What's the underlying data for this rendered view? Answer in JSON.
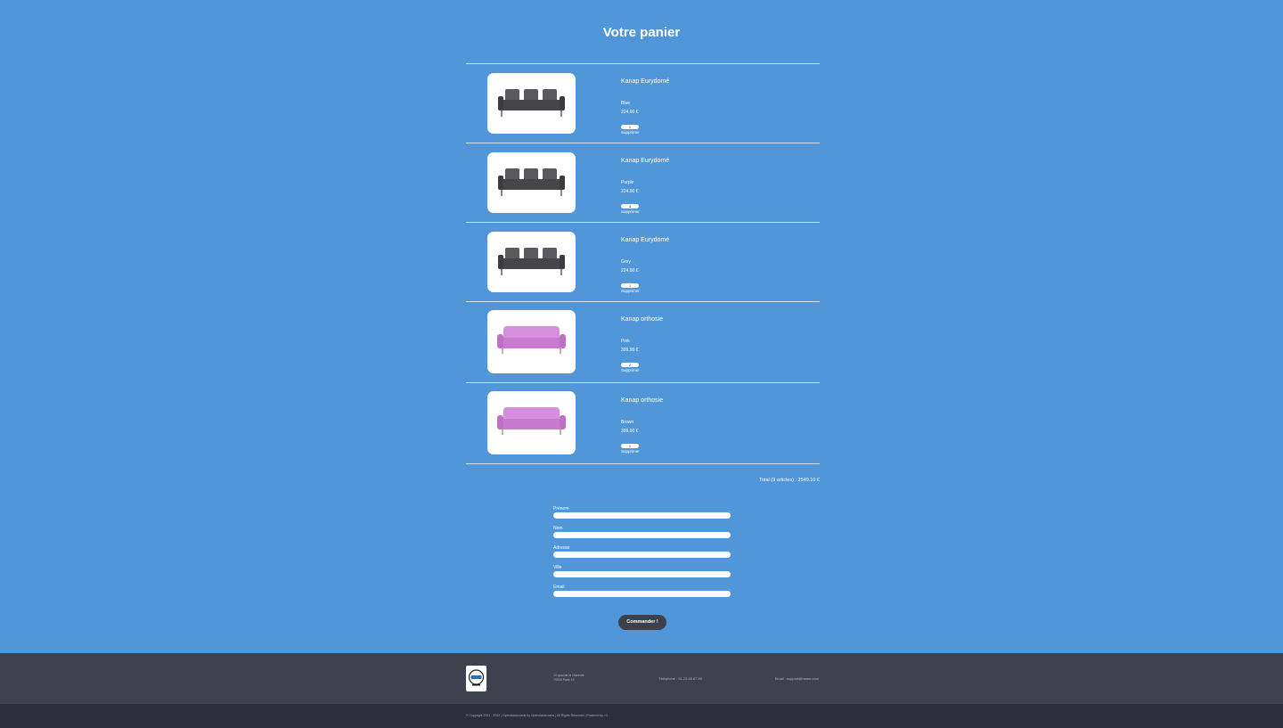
{
  "page": {
    "title": "Votre panier"
  },
  "cart": {
    "items": [
      {
        "name": "Kanap Eurydomé",
        "color": "Blue",
        "price": "224.90 €",
        "quantity": "1",
        "delete_label": "Supprimer",
        "image_icon": "grey-sofa"
      },
      {
        "name": "Kanap Eurydomé",
        "color": "Purple",
        "price": "224.90 €",
        "quantity": "4",
        "delete_label": "Supprimer",
        "image_icon": "grey-sofa"
      },
      {
        "name": "Kanap Eurydomé",
        "color": "Grey",
        "price": "224.90 €",
        "quantity": "1",
        "delete_label": "Supprimer",
        "image_icon": "grey-sofa"
      },
      {
        "name": "Kanap orthosie",
        "color": "Pink",
        "price": "399.90 €",
        "quantity": "2",
        "delete_label": "Supprimer",
        "image_icon": "pink-sofa"
      },
      {
        "name": "Kanap orthosie",
        "color": "Brown",
        "price": "399.90 €",
        "quantity": "1",
        "delete_label": "Supprimer",
        "image_icon": "pink-sofa"
      }
    ],
    "total_text": "Total (9 articles) : 2549.10 €"
  },
  "form": {
    "first_name_label": "Prénom",
    "last_name_label": "Nom",
    "address_label": "Adresse",
    "city_label": "Ville",
    "email_label": "Email",
    "submit_label": "Commander !"
  },
  "footer": {
    "address_line1": "10 quai de la charente",
    "address_line2": "75019 Paris 19",
    "phone": "Téléphone : 01 23 45 67 89",
    "email": "Email : support@name.com",
    "copyright": "© Copyright 2021 - 2042 | Openclassrooms by Openclassrooms | All Rights Reserved | Powered by <3"
  },
  "colors": {
    "background": "#5096d8",
    "footer_top": "#3f414c",
    "footer_bottom": "#2d2e39",
    "button": "#3d3f4b"
  }
}
